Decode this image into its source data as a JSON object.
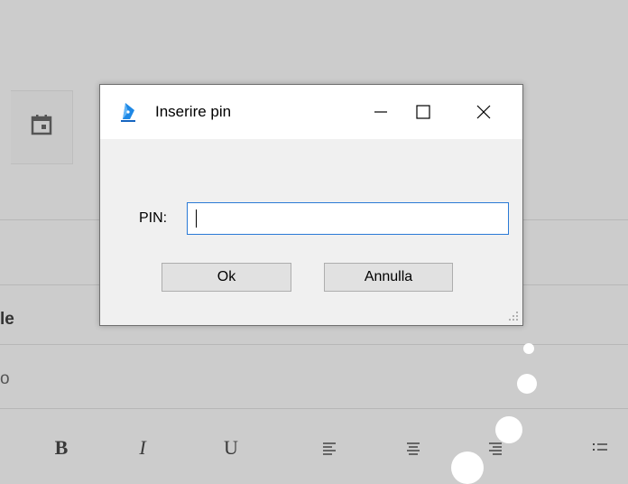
{
  "background": {
    "partial_label_1": "le",
    "partial_label_2": "o",
    "toolbar": [
      {
        "label": "B",
        "icon": "bold-icon"
      },
      {
        "label": "I",
        "icon": "italic-icon"
      },
      {
        "label": "U",
        "icon": "underline-icon"
      },
      {
        "icon": "align-left-icon"
      },
      {
        "icon": "align-center-icon"
      },
      {
        "icon": "align-right-icon"
      },
      {
        "icon": "bullet-list-icon"
      }
    ],
    "calendar_icon": "calendar-icon"
  },
  "dialog": {
    "title": "Inserire pin",
    "app_icon": "pen-nib-icon",
    "window_buttons": [
      "minimize-icon",
      "maximize-icon",
      "close-icon"
    ],
    "pin_label": "PIN:",
    "pin_value": "",
    "ok_label": "Ok",
    "cancel_label": "Annulla"
  },
  "colors": {
    "input_focus_border": "#2a7ad6",
    "app_icon_blue": "#1e88e5",
    "overlay": "#cccccc"
  }
}
